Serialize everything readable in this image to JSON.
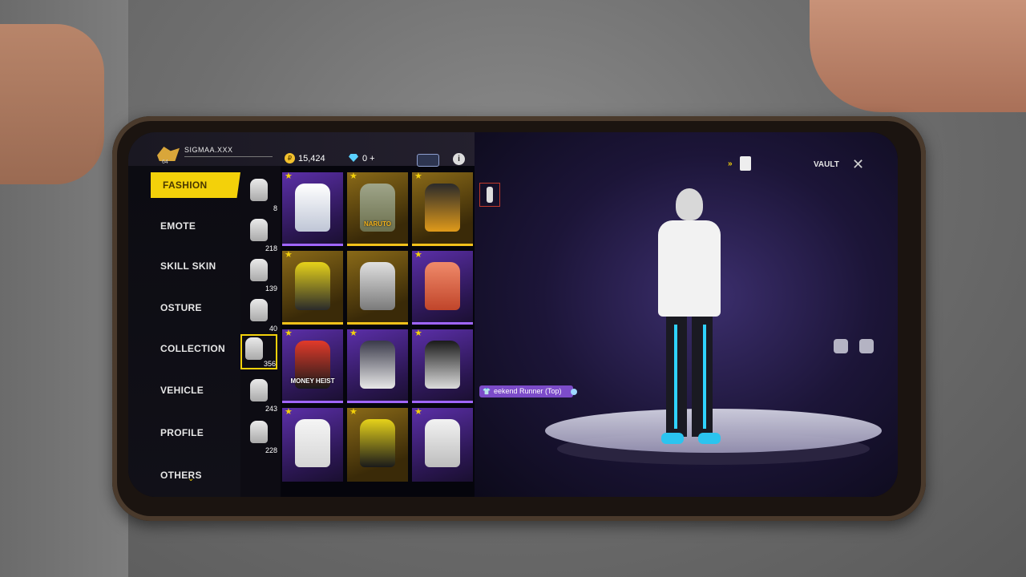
{
  "player": {
    "name": "SIGMAA.XXX",
    "level": "64"
  },
  "currency": {
    "coins": "15,424",
    "diamonds": "0 +"
  },
  "nav": {
    "items": [
      "FASHION",
      "EMOTE",
      "SKILL SKIN",
      "OSTURE",
      "COLLECTION",
      "VEHICLE",
      "PROFILE",
      "OTHERS"
    ],
    "active": "FASHION"
  },
  "subcategories": [
    "8",
    "218",
    "139",
    "40",
    "356",
    "243",
    "228"
  ],
  "grid": {
    "tags": [
      "",
      "NARUTO",
      "",
      "",
      "",
      "",
      "MONEY HEIST",
      "",
      "",
      "",
      "",
      ""
    ]
  },
  "scene": {
    "vault_label": "VAULT",
    "item_name": "eekend Runner (Top)"
  },
  "colors": {
    "accent": "#f3d10a",
    "rarity_purple": "#a066ff",
    "rarity_gold": "#f3c21a",
    "tag_bg": "#7c4cc9"
  }
}
